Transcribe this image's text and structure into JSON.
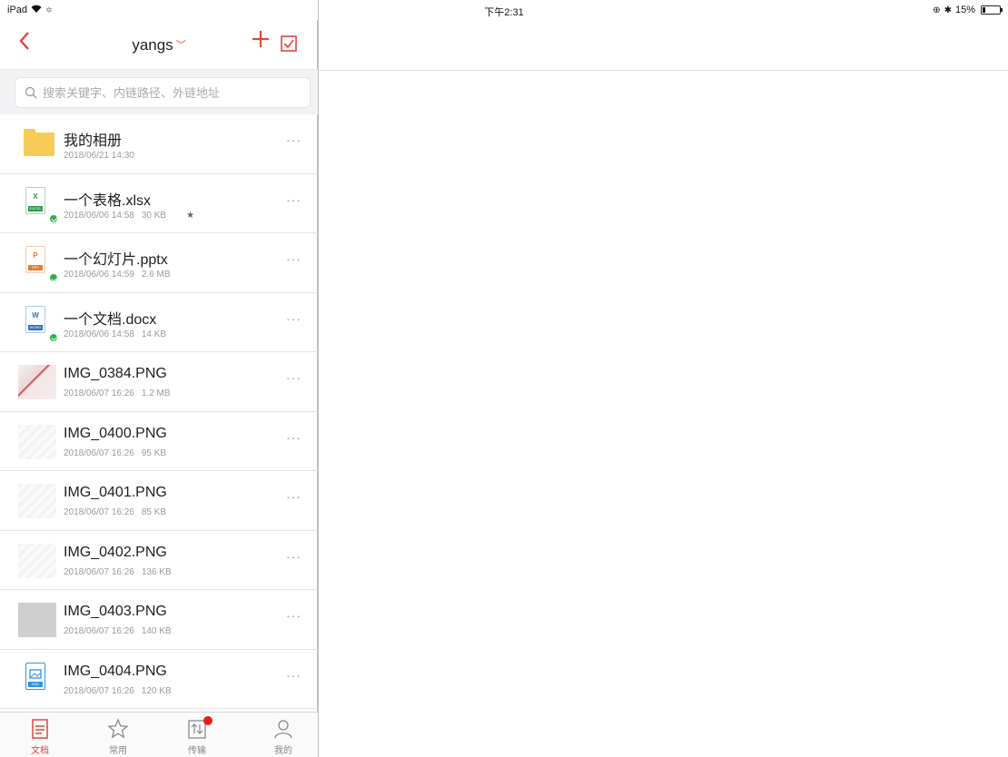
{
  "status_bar": {
    "device": "iPad",
    "time": "下午2:31",
    "battery_percent": "15%",
    "battery_level": 0.15
  },
  "nav": {
    "title": "yangs"
  },
  "search": {
    "placeholder": "搜索关键字、内链路径、外链地址"
  },
  "files": [
    {
      "type": "folder",
      "name": "我的相册",
      "date": "2018/06/21 14:30",
      "size": "",
      "synced": false
    },
    {
      "type": "xlsx",
      "name": "一个表格.xlsx",
      "date": "2018/06/06 14:58",
      "size": "30 KB",
      "synced": true,
      "starred": true
    },
    {
      "type": "pptx",
      "name": "一个幻灯片.pptx",
      "date": "2018/06/06 14:59",
      "size": "2.6 MB",
      "synced": true
    },
    {
      "type": "docx",
      "name": "一个文档.docx",
      "date": "2018/06/06 14:58",
      "size": "14 KB",
      "synced": true
    },
    {
      "type": "image-red",
      "name": "IMG_0384.PNG",
      "date": "2018/06/07 16:26",
      "size": "1.2 MB"
    },
    {
      "type": "image",
      "name": "IMG_0400.PNG",
      "date": "2018/06/07 16:26",
      "size": "95 KB"
    },
    {
      "type": "image",
      "name": "IMG_0401.PNG",
      "date": "2018/06/07 16:26",
      "size": "85 KB"
    },
    {
      "type": "image",
      "name": "IMG_0402.PNG",
      "date": "2018/06/07 16:26",
      "size": "136 KB"
    },
    {
      "type": "image-gray",
      "name": "IMG_0403.PNG",
      "date": "2018/06/07 16:26",
      "size": "140 KB"
    },
    {
      "type": "image-icon",
      "name": "IMG_0404.PNG",
      "date": "2018/06/07 16:26",
      "size": "120 KB"
    }
  ],
  "tabs": [
    {
      "label": "文档",
      "icon": "document-icon",
      "active": true
    },
    {
      "label": "常用",
      "icon": "star-icon",
      "active": false
    },
    {
      "label": "传输",
      "icon": "transfer-icon",
      "active": false,
      "badge": true
    },
    {
      "label": "我的",
      "icon": "profile-icon",
      "active": false
    }
  ],
  "colors": {
    "accent": "#e0463b",
    "excel": "#2e9a4f",
    "ppt": "#e97b2b",
    "word": "#2f6fbe",
    "image": "#2d95e8"
  }
}
